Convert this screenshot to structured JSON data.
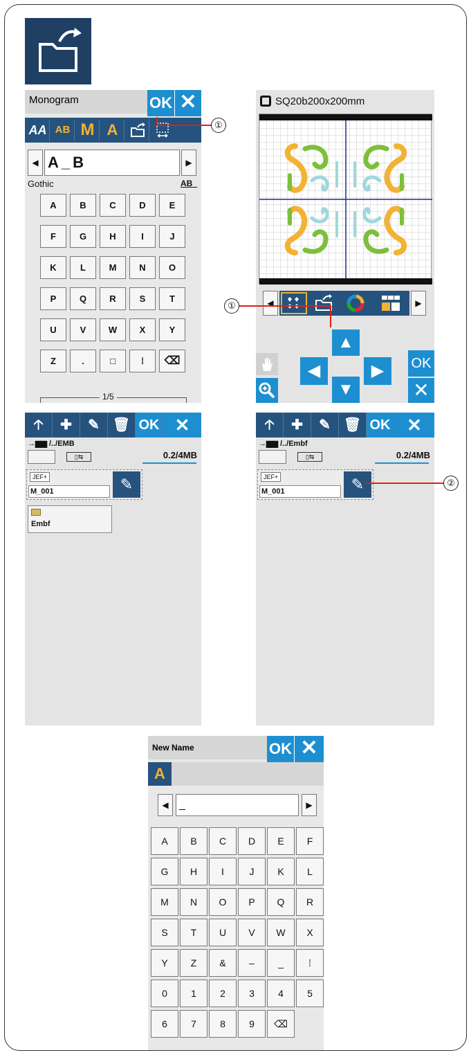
{
  "colors": {
    "dark_blue": "#26537d",
    "blue": "#1d8fd0",
    "pattern_orange": "#f2b233",
    "pattern_green": "#7dbf3a",
    "pattern_teal": "#9fd7dd",
    "callout_red": "#d21"
  },
  "callouts": {
    "c1": "①",
    "c2": "②"
  },
  "monogram": {
    "title": "Monogram",
    "ok": "OK",
    "cancel": "✕",
    "toolbar": [
      "AA",
      "AB",
      "M",
      "A"
    ],
    "text_value": "A_B",
    "font_name": "Gothic",
    "font_style_icon": "AB_",
    "keys": [
      "A",
      "B",
      "C",
      "D",
      "E",
      "F",
      "G",
      "H",
      "I",
      "J",
      "K",
      "L",
      "M",
      "N",
      "O",
      "P",
      "Q",
      "R",
      "S",
      "T",
      "U",
      "V",
      "W",
      "X",
      "Y",
      "Z",
      ".",
      "space",
      "ditto",
      "backspace"
    ],
    "key_labels": [
      "A",
      "B",
      "C",
      "D",
      "E",
      "F",
      "G",
      "H",
      "I",
      "J",
      "K",
      "L",
      "M",
      "N",
      "O",
      "P",
      "Q",
      "R",
      "S",
      "T",
      "U",
      "V",
      "W",
      "X",
      "Y",
      "Z",
      ".",
      "□",
      "⁞",
      "⌫"
    ],
    "page_indicator": "1/5"
  },
  "edit": {
    "hoop": "SQ20b200x200mm",
    "ok": "OK",
    "cancel": "✕"
  },
  "file_left": {
    "path": "/../EMB",
    "capacity": "0.2/4MB",
    "file_type": "JEF+",
    "file_name": "M_001",
    "folder_name": "Embf",
    "ok": "OK",
    "cancel": "✕"
  },
  "file_right": {
    "path": "/../Embf",
    "capacity": "0.2/4MB",
    "file_type": "JEF+",
    "file_name": "M_001",
    "ok": "OK",
    "cancel": "✕"
  },
  "newname": {
    "title": "New Name",
    "ok": "OK",
    "cancel": "✕",
    "text_value": "_",
    "key_labels": [
      "A",
      "B",
      "C",
      "D",
      "E",
      "F",
      "G",
      "H",
      "I",
      "J",
      "K",
      "L",
      "M",
      "N",
      "O",
      "P",
      "Q",
      "R",
      "S",
      "T",
      "U",
      "V",
      "W",
      "X",
      "Y",
      "Z",
      "&",
      "–",
      "_",
      "⁞",
      "0",
      "1",
      "2",
      "3",
      "4",
      "5",
      "6",
      "7",
      "8",
      "9",
      "⌫"
    ]
  }
}
